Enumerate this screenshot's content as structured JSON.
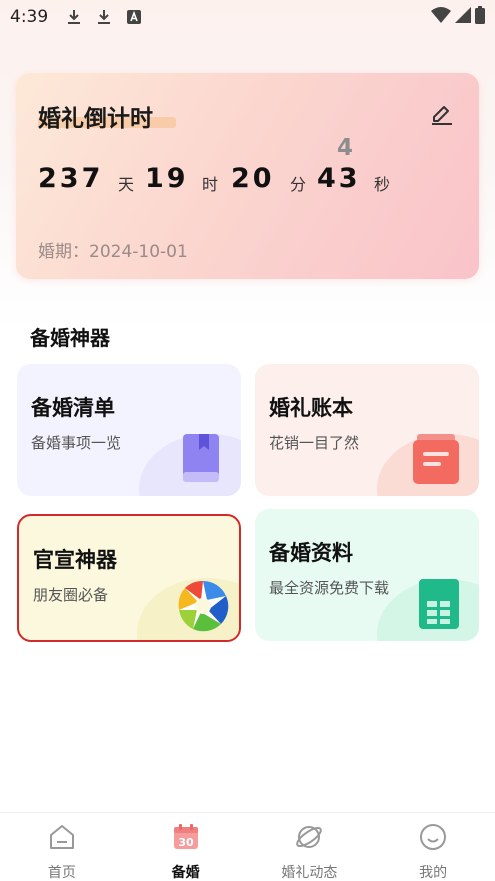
{
  "status_bar": {
    "time": "4:39",
    "icons": [
      "download-icon",
      "download-icon",
      "font-icon",
      "wifi-icon",
      "signal-icon",
      "battery-icon"
    ]
  },
  "countdown": {
    "title": "婚礼倒计时",
    "days": "237",
    "days_unit": "天",
    "hours": "19",
    "hours_unit": "时",
    "minutes": "20",
    "minutes_unit": "分",
    "seconds": "43",
    "seconds_unit": "秒",
    "seconds_prev_digit": "4",
    "date_label": "婚期：2024-10-01"
  },
  "section": {
    "title": "备婚神器"
  },
  "tools": [
    {
      "title": "备婚清单",
      "subtitle": "备婚事项一览",
      "icon": "book-icon"
    },
    {
      "title": "婚礼账本",
      "subtitle": "花销一目了然",
      "icon": "ledger-icon"
    },
    {
      "title": "官宣神器",
      "subtitle": "朋友圈必备",
      "icon": "aperture-icon"
    },
    {
      "title": "备婚资料",
      "subtitle": "最全资源免费下载",
      "icon": "spreadsheet-icon"
    }
  ],
  "nav": {
    "items": [
      {
        "label": "首页",
        "icon": "home-icon"
      },
      {
        "label": "备婚",
        "icon": "calendar-icon",
        "badge": "30"
      },
      {
        "label": "婚礼动态",
        "icon": "planet-icon"
      },
      {
        "label": "我的",
        "icon": "smiley-icon"
      }
    ],
    "active_index": 1
  },
  "colors": {
    "highlight_border": "#d22a2a",
    "active_nav": "#f08a8a"
  }
}
